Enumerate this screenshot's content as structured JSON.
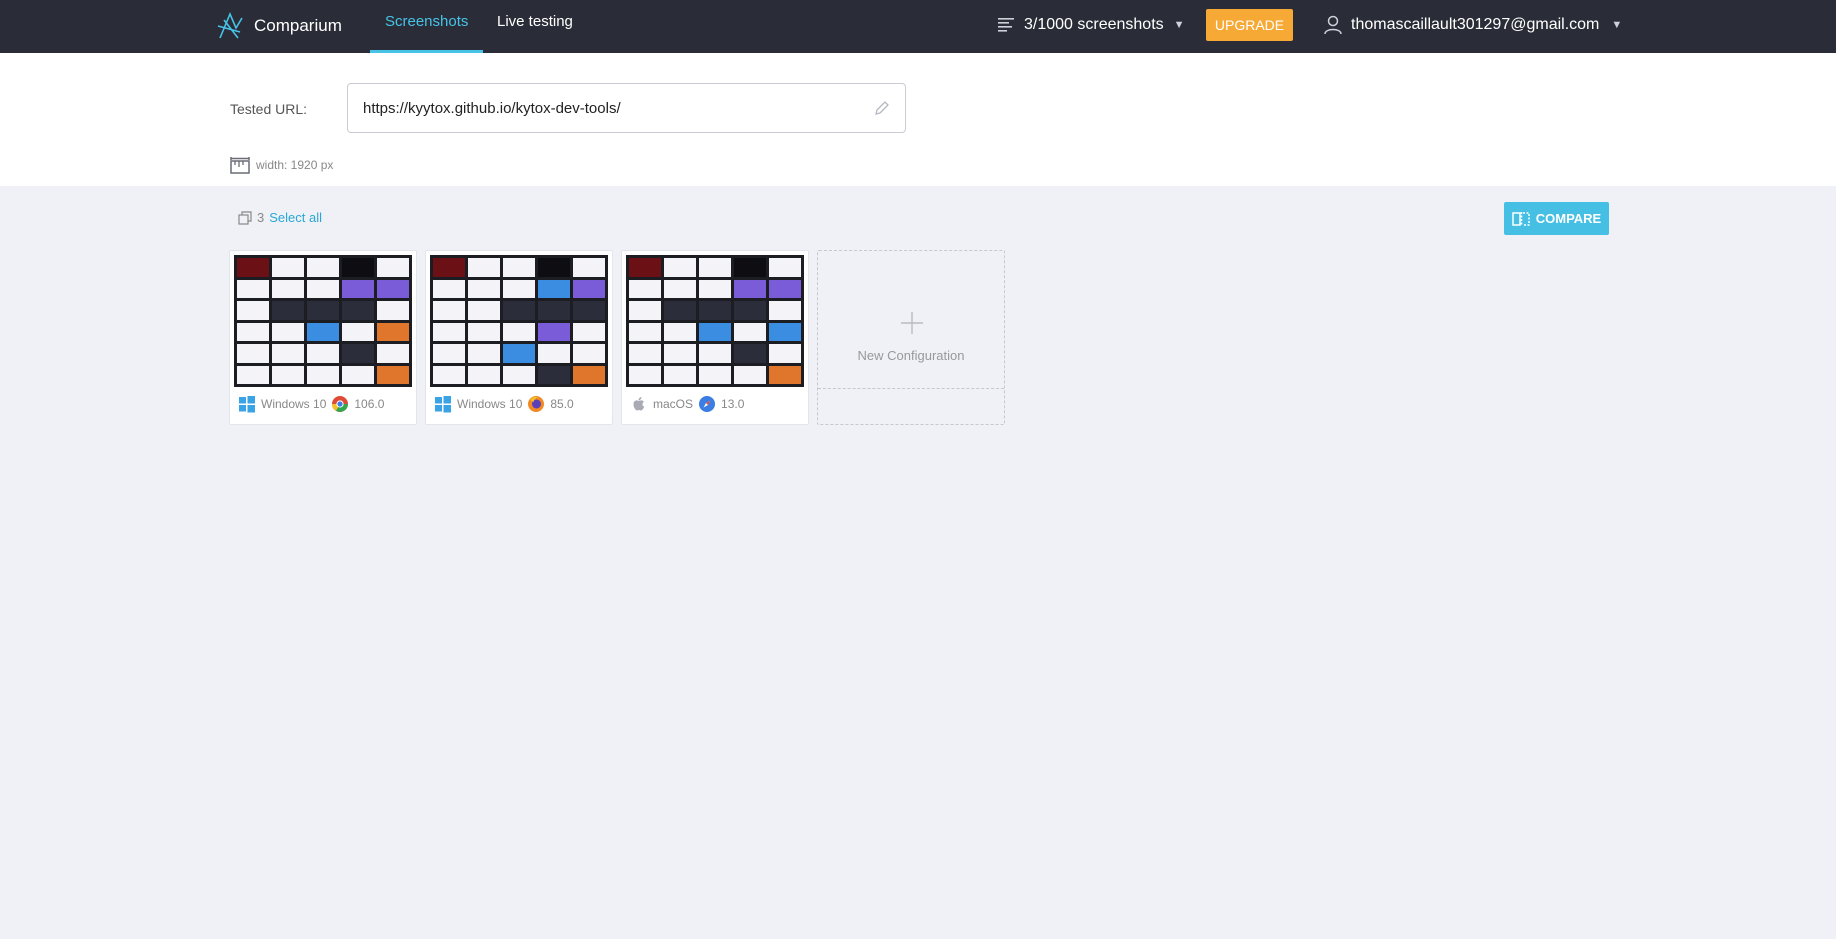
{
  "header": {
    "brand": "Comparium",
    "tabs": [
      {
        "label": "Screenshots",
        "active": true
      },
      {
        "label": "Live testing",
        "active": false
      }
    ],
    "quota": "3/1000 screenshots",
    "upgrade_label": "UPGRADE",
    "user_email": "thomascaillault301297@gmail.com"
  },
  "url_panel": {
    "label": "Tested URL:",
    "url": "https://kyytox.github.io/kytox-dev-tools/",
    "width_text": "width: 1920 px"
  },
  "toolbar": {
    "count": "3",
    "select_all": "Select all",
    "compare_label": "COMPARE"
  },
  "configurations": [
    {
      "os": "Windows 10",
      "os_icon": "windows-icon",
      "browser_icon": "chrome-icon",
      "version": "106.0"
    },
    {
      "os": "Windows 10",
      "os_icon": "windows-icon",
      "browser_icon": "firefox-icon",
      "version": "85.0"
    },
    {
      "os": "macOS",
      "os_icon": "apple-icon",
      "browser_icon": "safari-icon",
      "version": "13.0"
    }
  ],
  "new_config_label": "New Configuration",
  "colors": {
    "topbar": "#2a2d37",
    "accent": "#47c3e8",
    "upgrade": "#f7a936",
    "page_bg": "#f0f1f6"
  }
}
